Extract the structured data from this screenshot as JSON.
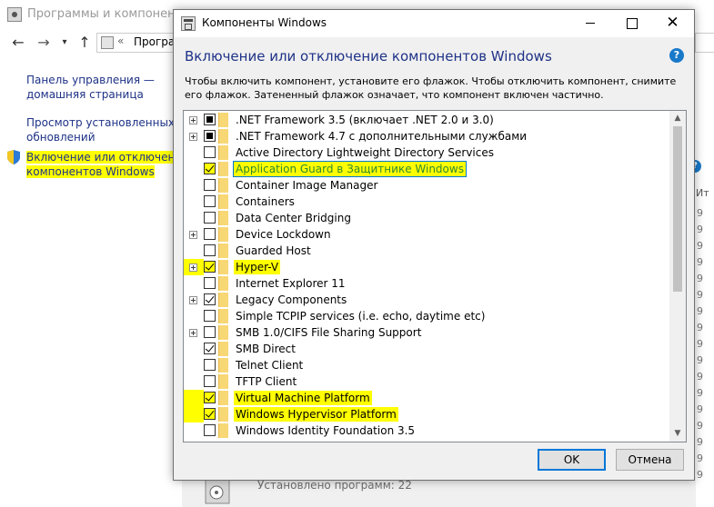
{
  "background_window": {
    "title": "Программы и компоненты",
    "address_text": "Програ",
    "sidebar_links": [
      {
        "line1": "Панель управления —",
        "line2": "домашняя страница"
      },
      {
        "line1": "Просмотр установленных",
        "line2": "обновлений"
      },
      {
        "line1": "Включение или отключение",
        "line2": "компонентов Windows"
      }
    ],
    "right_column_header": "Ит",
    "right_column_digits": [
      "9",
      "9",
      "9",
      "9",
      "9",
      "9",
      "9",
      "9",
      "9",
      "9",
      "9",
      "9",
      "9",
      "9",
      "9",
      "9",
      "9"
    ],
    "status_text": "Установлено программ: 22"
  },
  "dialog": {
    "title": "Компоненты Windows",
    "heading": "Включение или отключение компонентов Windows",
    "help_glyph": "?",
    "description": "Чтобы включить компонент, установите его флажок. Чтобы отключить компонент, снимите его флажок. Затененный флажок означает, что компонент включен частично.",
    "features": [
      {
        "label": ".NET Framework 3.5 (включает .NET 2.0 и 3.0)",
        "state": "partial",
        "expandable": true,
        "highlight": false
      },
      {
        "label": ".NET Framework 4.7 с дополнительными службами",
        "state": "partial",
        "expandable": true,
        "highlight": false
      },
      {
        "label": "Active Directory Lightweight Directory Services",
        "state": "unchecked",
        "expandable": false,
        "highlight": false
      },
      {
        "label": "Application Guard в Защитнике Windows",
        "state": "checked",
        "expandable": false,
        "highlight": true,
        "selected": true
      },
      {
        "label": "Container Image Manager",
        "state": "unchecked",
        "expandable": false,
        "highlight": false
      },
      {
        "label": "Containers",
        "state": "unchecked",
        "expandable": false,
        "highlight": false
      },
      {
        "label": "Data Center Bridging",
        "state": "unchecked",
        "expandable": false,
        "highlight": false
      },
      {
        "label": "Device Lockdown",
        "state": "unchecked",
        "expandable": true,
        "highlight": false
      },
      {
        "label": "Guarded Host",
        "state": "unchecked",
        "expandable": false,
        "highlight": false
      },
      {
        "label": "Hyper-V",
        "state": "checked",
        "expandable": true,
        "highlight": true
      },
      {
        "label": "Internet Explorer 11",
        "state": "unchecked",
        "expandable": false,
        "highlight": false
      },
      {
        "label": "Legacy Components",
        "state": "checked",
        "expandable": true,
        "highlight": false
      },
      {
        "label": "Simple TCPIP services (i.e. echo, daytime etc)",
        "state": "unchecked",
        "expandable": false,
        "highlight": false
      },
      {
        "label": "SMB 1.0/CIFS File Sharing Support",
        "state": "unchecked",
        "expandable": true,
        "highlight": false
      },
      {
        "label": "SMB Direct",
        "state": "checked",
        "expandable": false,
        "highlight": false
      },
      {
        "label": "Telnet Client",
        "state": "unchecked",
        "expandable": false,
        "highlight": false
      },
      {
        "label": "TFTP Client",
        "state": "unchecked",
        "expandable": false,
        "highlight": false
      },
      {
        "label": "Virtual Machine Platform",
        "state": "checked",
        "expandable": false,
        "highlight": true
      },
      {
        "label": "Windows Hypervisor Platform",
        "state": "checked",
        "expandable": false,
        "highlight": true
      },
      {
        "label": "Windows Identity Foundation 3.5",
        "state": "unchecked",
        "expandable": false,
        "highlight": false
      }
    ],
    "ok_label": "OK",
    "cancel_label": "Отмена"
  },
  "colors": {
    "link": "#1e3287",
    "highlight": "#ffff00",
    "accent": "#0078d7",
    "help_blue": "#1979c9"
  }
}
